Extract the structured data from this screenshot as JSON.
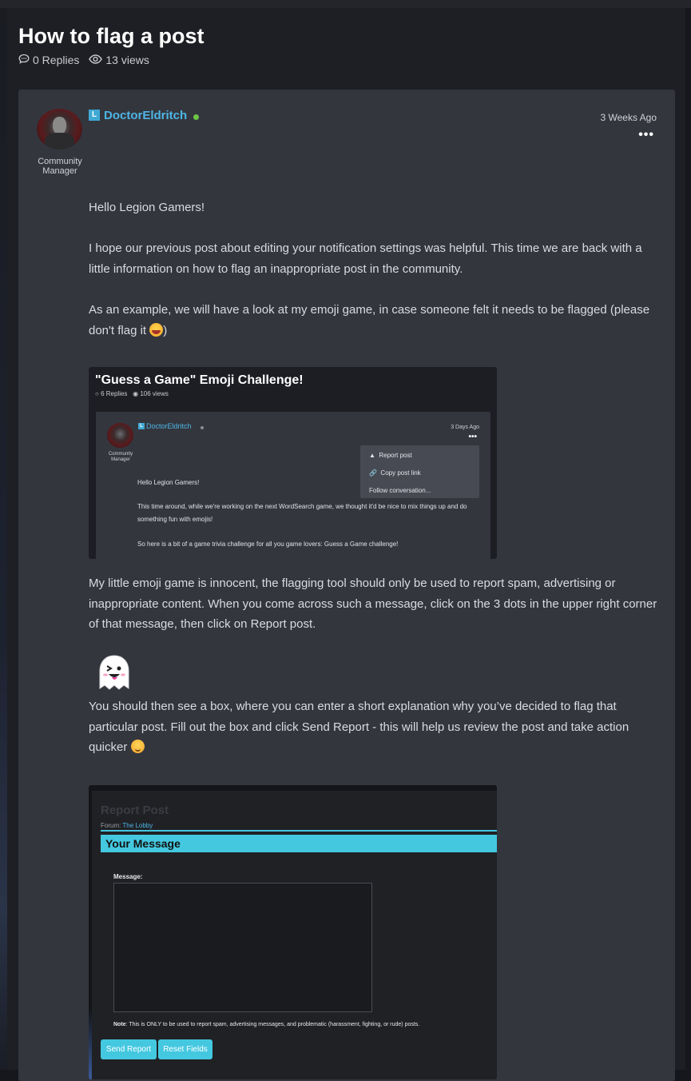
{
  "thread": {
    "title": "How to flag a post",
    "replies": "0 Replies",
    "views": "13 views"
  },
  "post": {
    "badge": "L",
    "author": "DoctorEldritch",
    "role": "Community Manager",
    "time": "3 Weeks Ago",
    "menu_icon": "more-horizontal-icon",
    "paragraphs": {
      "greeting": "Hello Legion Gamers!",
      "p1": "I hope our previous post about editing your notification settings was helpful. This time we are back with a little information on how to flag an inappropriate post in the community.",
      "p2": "As an example, we will have a look at my emoji game, in case someone felt it needs to be flagged (please don't flag it",
      "p2_end": ")",
      "p3": "My little emoji game is innocent, the flagging tool should only be used to report spam, advertising or inappropriate content. When you come across such a message, click on the 3 dots in the upper right corner of that message, then click on Report post.",
      "p4": "You should then see a box, where you can enter a short explanation why you’ve decided to flag that particular post. Fill out the box and click Send Report - this will help us review the post and take action quicker"
    }
  },
  "screenshot1": {
    "title": "\"Guess a Game\" Emoji Challenge!",
    "replies": "6 Replies",
    "views": "106 views",
    "author": "DoctorEldritch",
    "badge": "L",
    "role": "Community Manager",
    "time": "3 Days Ago",
    "menu": [
      "Report post",
      "Copy post link",
      "Follow conversation..."
    ],
    "greeting": "Hello Legion Gamers!",
    "line1": "This time around, while we're working on the next WordSearch game, we thought it'd be nice to mix things up and do something fun with emojis!",
    "line2": "So here is a bit of a game trivia challenge for all you game lovers: Guess a Game challenge!"
  },
  "screenshot2": {
    "heading": "Report Post",
    "forum_label": "Forum:",
    "forum_name": "The Lobby",
    "bar_title": "Your Message",
    "message_label": "Message:",
    "note_bold": "Note",
    "note_text": ": This is ONLY to be used to report spam, advertising messages, and problematic (harassment, fighting, or rude) posts.",
    "send_button": "Send Report",
    "reset_button": "Reset Fields"
  },
  "colors": {
    "accent": "#4db6e6",
    "online": "#6cc644",
    "report_bar": "#44c8e0",
    "card": "#34363e"
  }
}
